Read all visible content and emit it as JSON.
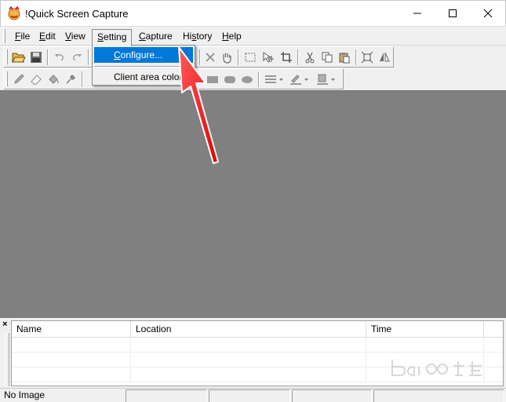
{
  "window": {
    "title": "!Quick Screen Capture"
  },
  "menubar": {
    "items": [
      {
        "label": "File",
        "mnemonic": "F",
        "rest": "ile"
      },
      {
        "label": "Edit",
        "mnemonic": "E",
        "rest": "dit"
      },
      {
        "label": "View",
        "mnemonic": "V",
        "rest": "iew"
      },
      {
        "label": "Setting",
        "mnemonic": "S",
        "rest": "etting"
      },
      {
        "label": "Capture",
        "mnemonic": "C",
        "rest": "apture"
      },
      {
        "label": "History",
        "mnemonic": "H",
        "pre": "Hi",
        "mid": "s",
        "rest": "tory"
      },
      {
        "label": "Help",
        "mnemonic": "H",
        "rest": "elp"
      }
    ]
  },
  "setting_menu": {
    "configure": {
      "pre": "",
      "mnemonic": "C",
      "rest": "onfigure..."
    },
    "client_area": "Client area color..."
  },
  "toolbar1": {
    "icons": [
      "open-folder-icon",
      "save-icon",
      "undo-icon",
      "redo-icon",
      "delete-icon",
      "hand-icon",
      "select-rect-icon",
      "move-icon",
      "crop-icon",
      "cut-icon",
      "copy-icon",
      "paste-icon",
      "resize-icon",
      "flip-icon"
    ]
  },
  "toolbar2": {
    "icons": [
      "pencil-icon",
      "eraser-icon",
      "fill-bucket-icon",
      "eyedropper-icon",
      "rectangle-fill-icon",
      "rounded-rect-icon",
      "ellipse-icon",
      "line-width-icon",
      "line-color-icon",
      "fill-color-icon"
    ]
  },
  "list": {
    "close_glyph": "×",
    "columns": [
      "Name",
      "Location",
      "Time",
      ""
    ],
    "rows": [
      [],
      [],
      []
    ]
  },
  "statusbar": {
    "text": "No Image"
  },
  "colors": {
    "menu_highlight": "#0078d7",
    "workspace": "#808080",
    "arrow": "#ff1a1a"
  }
}
